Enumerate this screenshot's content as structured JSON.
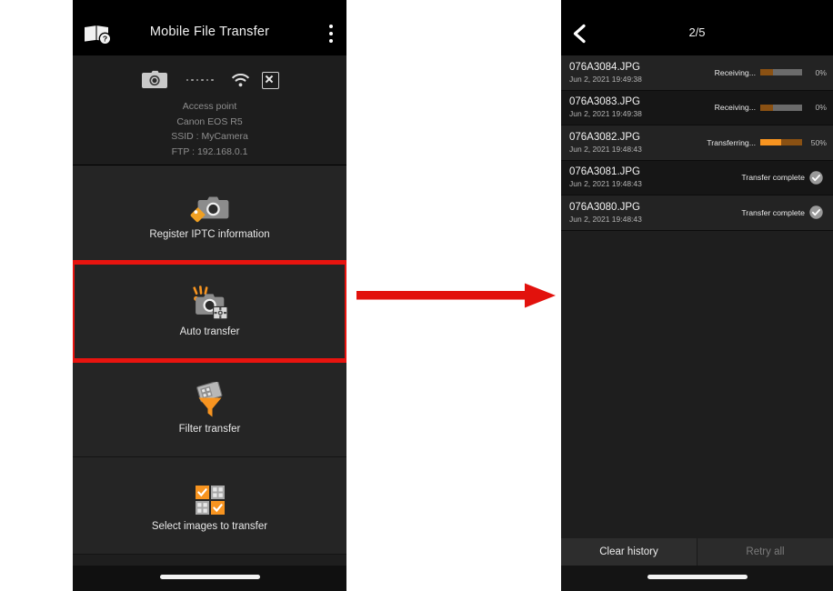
{
  "accent": {
    "highlight_red": "#e8140f",
    "arrow_red": "#e2120d",
    "orange_bright": "#f79420",
    "orange_dark": "#8a5113",
    "bar_track": "#6b6b6b",
    "tag_orange": "#f0a022"
  },
  "left_phone": {
    "title": "Mobile File Transfer",
    "manual_icon": "manual-help-icon",
    "overflow_icon": "kebab-menu-icon",
    "connection": {
      "camera_icon": "camera-icon",
      "link_icon": "connection-dots-icon",
      "wifi_icon": "wifi-icon",
      "disconnect_icon": "disconnect-x-icon",
      "lines": [
        "Access point",
        "Canon EOS R5",
        "SSID : MyCamera",
        "FTP : 192.168.0.1"
      ]
    },
    "menu": [
      {
        "label": "Register IPTC information",
        "icon": "camera-tag-icon",
        "highlighted": false
      },
      {
        "label": "Auto transfer",
        "icon": "camera-auto-transfer-icon",
        "highlighted": true
      },
      {
        "label": "Filter transfer",
        "icon": "funnel-filter-icon",
        "highlighted": false
      },
      {
        "label": "Select images to transfer",
        "icon": "select-images-grid-icon",
        "highlighted": false
      }
    ],
    "home_indicator": "home-indicator"
  },
  "arrow": {
    "name": "flow-arrow-right",
    "direction": "right"
  },
  "right_phone": {
    "back_icon": "back-chevron-icon",
    "page_count": "2/5",
    "transfers": [
      {
        "filename": "076A3084.JPG",
        "timestamp": "Jun 2, 2021 19:49:38",
        "status": "Receiving...",
        "percent": "0%",
        "state": "receiving",
        "bar_primary_pct": 30,
        "bar_secondary_pct": 0
      },
      {
        "filename": "076A3083.JPG",
        "timestamp": "Jun 2, 2021 19:49:38",
        "status": "Receiving...",
        "percent": "0%",
        "state": "receiving",
        "bar_primary_pct": 30,
        "bar_secondary_pct": 0
      },
      {
        "filename": "076A3082.JPG",
        "timestamp": "Jun 2, 2021 19:48:43",
        "status": "Transferring...",
        "percent": "50%",
        "state": "transferring",
        "bar_primary_pct": 50,
        "bar_secondary_pct": 50
      },
      {
        "filename": "076A3081.JPG",
        "timestamp": "Jun 2, 2021 19:48:43",
        "status": "Transfer complete",
        "percent": "",
        "state": "complete",
        "icon": "check-circle-icon"
      },
      {
        "filename": "076A3080.JPG",
        "timestamp": "Jun 2, 2021 19:48:43",
        "status": "Transfer complete",
        "percent": "",
        "state": "complete",
        "icon": "check-circle-icon"
      }
    ],
    "buttons": [
      {
        "label": "Clear history",
        "disabled": false
      },
      {
        "label": "Retry all",
        "disabled": true
      }
    ],
    "home_indicator": "home-indicator"
  }
}
